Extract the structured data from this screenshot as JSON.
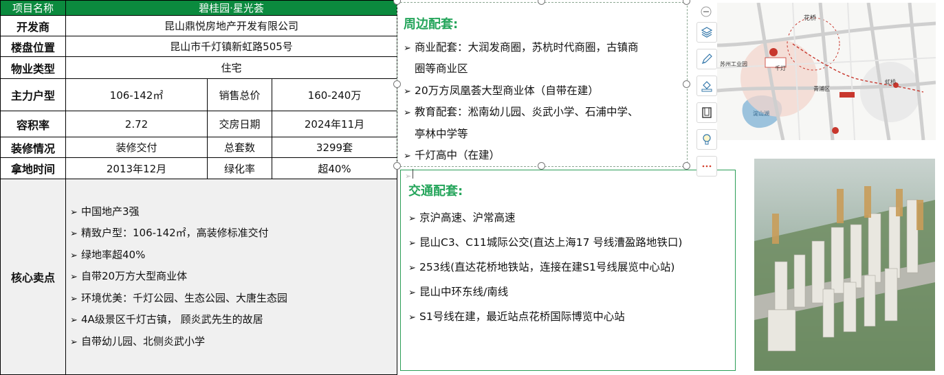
{
  "table": {
    "project_name_label": "项目名称",
    "project_name": "碧桂园·星光荟",
    "developer_label": "开发商",
    "developer": "昆山鼎悦房地产开发有限公司",
    "location_label": "楼盘位置",
    "location": "昆山市千灯镇新虹路505号",
    "property_type_label": "物业类型",
    "property_type": "住宅",
    "main_units_label": "主力户型",
    "main_units": "106-142㎡",
    "total_price_label": "销售总价",
    "total_price": "160-240万",
    "far_label": "容积率",
    "far": "2.72",
    "delivery_label": "交房日期",
    "delivery": "2024年11月",
    "decoration_label": "装修情况",
    "decoration": "装修交付",
    "total_units_label": "总套数",
    "total_units": "3299套",
    "land_time_label": "拿地时间",
    "land_time": "2013年12月",
    "green_rate_label": "绿化率",
    "green_rate": "超40%",
    "selling_points_label": "核心卖点",
    "selling_points": [
      "中国地产3强",
      "精致户型：106-142㎡，高装修标准交付",
      "绿地率超40%",
      "自带20万方大型商业体",
      "环境优美：千灯公园、生态公园、大唐生态园",
      "4A级景区千灯古镇， 顾炎武先生的故居",
      "自带幼儿园、北侧炎武小学"
    ]
  },
  "peripheral": {
    "title": "周边配套:",
    "items": [
      "商业配套：大润发商圈，苏杭时代商圈，古镇商",
      "圈等商业区",
      "20万方凤凰荟大型商业体（自带在建）",
      "教育配套：淞南幼儿园、炎武小学、石浦中学、",
      "亭林中学等",
      "千灯高中（在建）"
    ]
  },
  "traffic": {
    "title": "交通配套:",
    "items": [
      "京沪高速、沪常高速",
      "昆山C3、C11城际公交(直达上海17 号线漕盈路地铁口)",
      "253线(直达花桥地铁站，连接在建S1号线展览中心站)",
      "昆山中环东线/南线",
      "S1号线在建，最近站点花桥国际博览中心站"
    ]
  },
  "toolbar": {
    "icons": [
      "collapse-icon",
      "layers-icon",
      "pen-icon",
      "fill-icon",
      "frame-icon",
      "lightbulb-icon",
      "more-icon"
    ]
  },
  "map": {
    "labels": {
      "huaqiao": "花桥",
      "suzhou_park": "苏州工业园",
      "qiandeng": "千灯",
      "qingpu": "青浦区",
      "hongqiao": "虹桥",
      "dianshan_lake": "淀山湖"
    }
  },
  "colors": {
    "header_green": "#0b8a3e",
    "title_green": "#25a55b",
    "map_accent": "#c8372d"
  }
}
